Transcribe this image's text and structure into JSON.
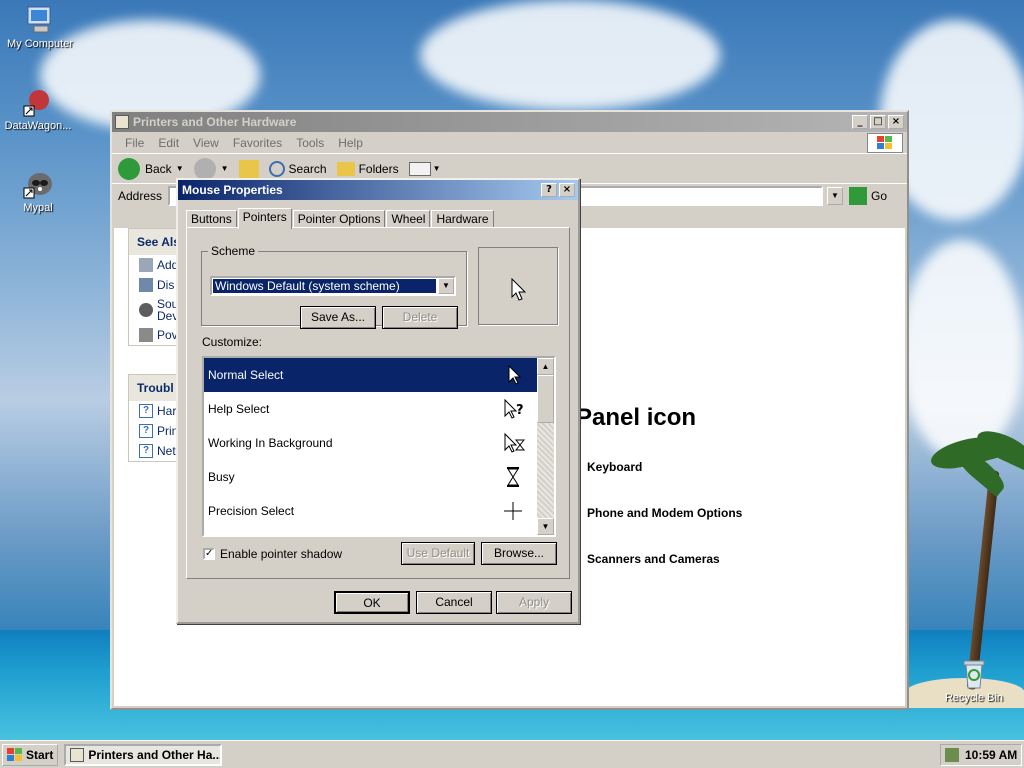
{
  "desktop": {
    "icons": [
      {
        "label": "My Computer"
      },
      {
        "label": "DataWagon..."
      },
      {
        "label": "Mypal"
      },
      {
        "label": "Recycle Bin"
      }
    ]
  },
  "explorer": {
    "title": "Printers and Other Hardware",
    "menu": [
      "File",
      "Edit",
      "View",
      "Favorites",
      "Tools",
      "Help"
    ],
    "toolbar": {
      "back": "Back",
      "search": "Search",
      "folders": "Folders"
    },
    "address_label": "Address",
    "go_label": "Go",
    "see_also_title": "See Als",
    "see_also_items": [
      "Add",
      "Dis",
      "Sou Dev",
      "Pov"
    ],
    "troubleshoot_title": "Troubl",
    "troubleshoot_items": [
      "Har",
      "Prin",
      "Net"
    ],
    "panel_heading": "Panel icon",
    "links": [
      "Keyboard",
      "Phone and Modem Options",
      "Scanners and Cameras"
    ]
  },
  "dialog": {
    "title": "Mouse Properties",
    "tabs": [
      "Buttons",
      "Pointers",
      "Pointer Options",
      "Wheel",
      "Hardware"
    ],
    "active_tab": "Pointers",
    "scheme_legend": "Scheme",
    "scheme_value": "Windows Default (system scheme)",
    "save_as_label": "Save As...",
    "delete_label": "Delete",
    "customize_label": "Customize:",
    "pointer_list": [
      {
        "name": "Normal Select",
        "icon": "arrow-cursor-icon"
      },
      {
        "name": "Help Select",
        "icon": "help-cursor-icon"
      },
      {
        "name": "Working In Background",
        "icon": "working-cursor-icon"
      },
      {
        "name": "Busy",
        "icon": "hourglass-cursor-icon"
      },
      {
        "name": "Precision Select",
        "icon": "crosshair-cursor-icon"
      }
    ],
    "pointer_shadow_label": "Enable pointer shadow",
    "pointer_shadow_checked": true,
    "use_default_label": "Use Default",
    "browse_label": "Browse...",
    "ok_label": "OK",
    "cancel_label": "Cancel",
    "apply_label": "Apply"
  },
  "taskbar": {
    "start_label": "Start",
    "task_label": "Printers and Other Ha...",
    "clock": "10:59 AM"
  }
}
